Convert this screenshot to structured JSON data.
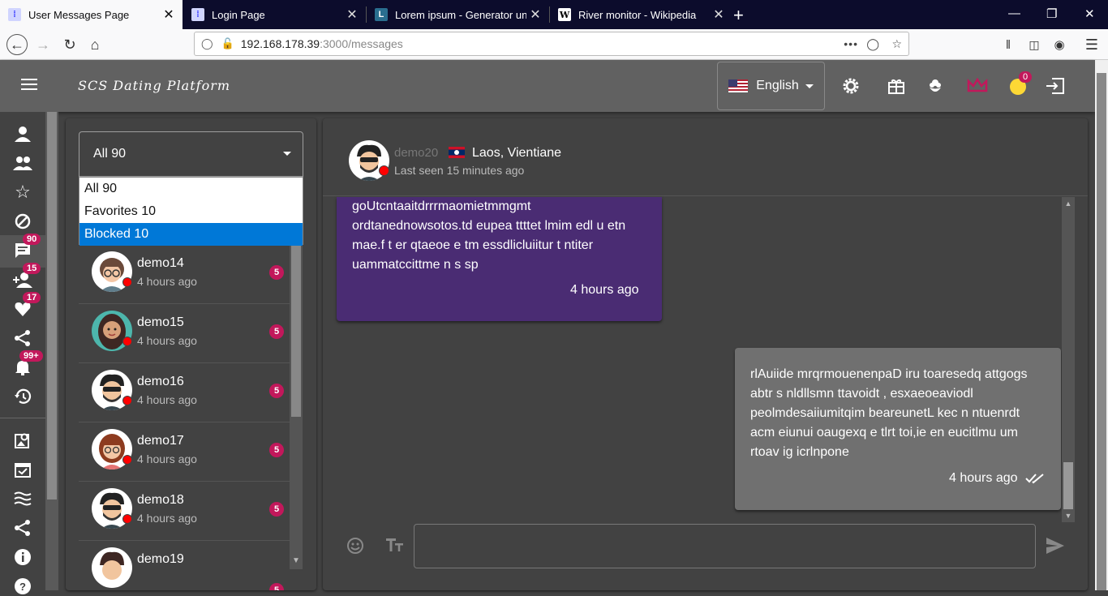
{
  "browser": {
    "tabs": [
      {
        "title": "User Messages Page",
        "active": true,
        "icon": "page-favicon-icon"
      },
      {
        "title": "Login Page",
        "active": false,
        "icon": "page-favicon-icon"
      },
      {
        "title": "Lorem ipsum - Generator und I",
        "active": false,
        "icon": "lorem-favicon-icon"
      },
      {
        "title": "River monitor - Wikipedia",
        "active": false,
        "icon": "wikipedia-favicon-icon"
      }
    ],
    "url_host": "192.168.178.39",
    "url_path": ":3000/messages",
    "new_tab_label": "+",
    "close_glyph": "✕"
  },
  "app": {
    "brand": "SCS Dating Platform",
    "language": "English",
    "header_badge": "0",
    "rail_badges": {
      "messages": "90",
      "requests": "15",
      "likes": "17",
      "notifications": "99+"
    }
  },
  "filter": {
    "selected": "All 90",
    "options": [
      "All 90",
      "Favorites 10",
      "Blocked 10"
    ],
    "highlighted": "Blocked 10"
  },
  "conversations": [
    {
      "name": "demo14",
      "time": "4 hours ago",
      "count": "5",
      "avatar": "woman-glasses-avatar"
    },
    {
      "name": "demo15",
      "time": "4 hours ago",
      "count": "5",
      "avatar": "woman-long-hair-avatar"
    },
    {
      "name": "demo16",
      "time": "4 hours ago",
      "count": "5",
      "avatar": "man-beard-sunglasses-avatar"
    },
    {
      "name": "demo17",
      "time": "4 hours ago",
      "count": "5",
      "avatar": "woman-red-hair-avatar"
    },
    {
      "name": "demo18",
      "time": "4 hours ago",
      "count": "5",
      "avatar": "man-beard-sunglasses-avatar"
    },
    {
      "name": "demo19",
      "time": "",
      "count": "5",
      "avatar": "man-avatar"
    }
  ],
  "chat": {
    "user": "demo20",
    "location": "Laos, Vientiane",
    "last_seen": "Last seen 15 minutes ago",
    "messages": [
      {
        "direction": "in",
        "text": "goUtcntaaitdrrrmaomietmmgmt\nordtanednowsotos.td eupea ttttet lmim edl  u etn\nmae.f t  er qtaeoe e  tm essdlicluiitur t ntiter\nuammatccittme   n s sp",
        "time": "4 hours ago"
      },
      {
        "direction": "out",
        "text": "rlAuiide mrqrmouenenpaD iru   toaresedq attgogs\nabtr s nldllsmn ttavoidt , esxaeoeaviodl\npeolmdesaiiumitqim beareunetL kec n ntuenrdt\nacm eiunui oaugexq e tlrt toi,ie en eucitlmu um\nrtoav ig icrlnpone",
        "time": "4 hours ago"
      }
    ],
    "composer_placeholder": ""
  },
  "colors": {
    "accent": "#c2185b",
    "incoming_bubble": "#4a2c73",
    "outgoing_bubble": "#707070",
    "status_offline": "#ff0000",
    "selected_option": "#0078d7"
  }
}
